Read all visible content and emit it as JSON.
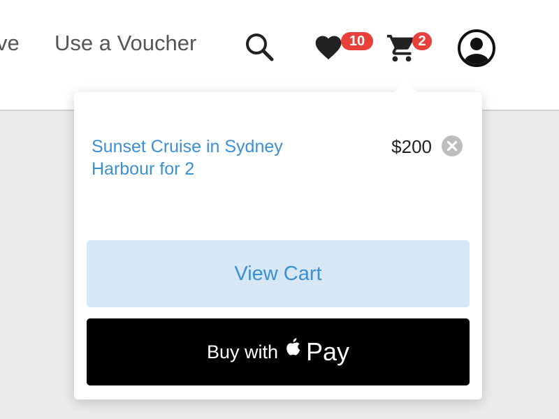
{
  "header": {
    "nav_partial": "Give",
    "nav_voucher": "Use a Voucher",
    "wishlist_count": "10",
    "cart_count": "2",
    "icons": {
      "search": "search-icon",
      "wishlist": "heart-icon",
      "cart": "cart-icon",
      "account": "user-account-icon"
    }
  },
  "cart_dropdown": {
    "item": {
      "title": "Sunset Cruise in Sydney Harbour for 2",
      "price": "$200"
    },
    "view_cart_label": "View Cart",
    "apple_pay": {
      "prefix": "Buy with",
      "brand": "Pay"
    }
  },
  "colors": {
    "accent": "#3c8fd1",
    "badge": "#e8413b",
    "view_cart_bg": "#d6e8f6",
    "apple_pay_bg": "#000000",
    "page_bg": "#ebebeb"
  }
}
